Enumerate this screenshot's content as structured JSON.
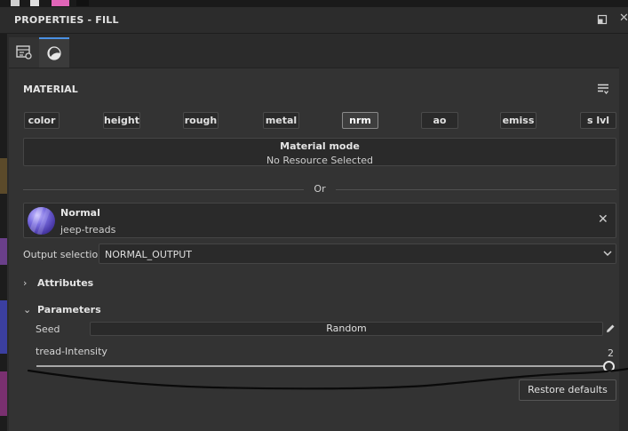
{
  "window": {
    "title": "PROPERTIES - FILL"
  },
  "tabs": [
    {
      "icon": "layer-properties-icon"
    },
    {
      "icon": "material-sphere-icon",
      "active": true
    }
  ],
  "material": {
    "section_title": "MATERIAL",
    "channels": [
      "color",
      "height",
      "rough",
      "metal",
      "nrm",
      "ao",
      "emiss",
      "s lvl"
    ],
    "active_channel": "nrm",
    "mode_title": "Material mode",
    "mode_value": "No Resource Selected",
    "separator_text": "Or"
  },
  "resource": {
    "name": "Normal",
    "subtitle": "jeep-treads"
  },
  "output": {
    "label": "Output selection",
    "value": "NORMAL_OUTPUT"
  },
  "attributes": {
    "label": "Attributes",
    "expanded": false
  },
  "parameters": {
    "label": "Parameters",
    "expanded": true,
    "seed_label": "Seed",
    "seed_value": "Random",
    "intensity_label": "tread-Intensity",
    "intensity_value": "2"
  },
  "footer": {
    "restore_label": "Restore defaults"
  },
  "colors": {
    "accent": "#4a90e2",
    "panel": "#333333",
    "field": "#2a2a2a"
  }
}
